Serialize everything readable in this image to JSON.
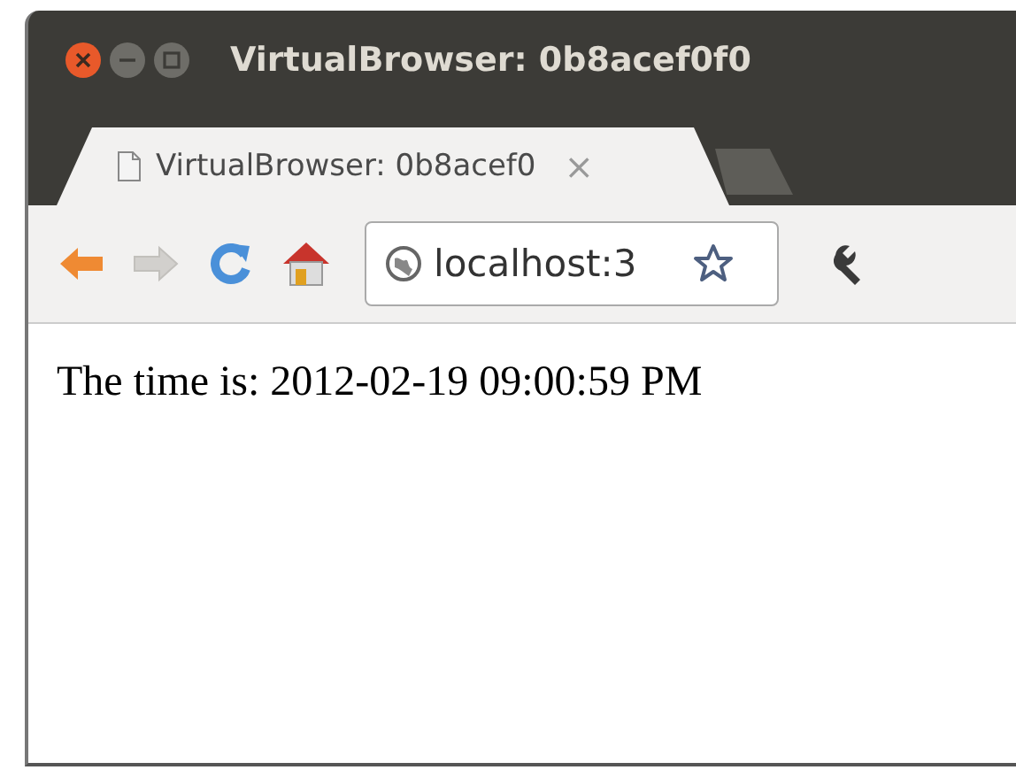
{
  "window": {
    "title": "VirtualBrowser: 0b8acef0f0"
  },
  "tabs": [
    {
      "label": "VirtualBrowser: 0b8acef0",
      "close": "×",
      "selected": true
    }
  ],
  "toolbar": {
    "buttons": [
      {
        "kind": "back",
        "disabled": false
      },
      {
        "kind": "forward",
        "disabled": true
      },
      {
        "kind": "reload",
        "disabled": false
      },
      {
        "kind": "home",
        "disabled": false
      }
    ],
    "address": {
      "value": "localhost:3"
    }
  },
  "page": {
    "text": "The time is: 2012-02-19 09:00:59 PM"
  }
}
